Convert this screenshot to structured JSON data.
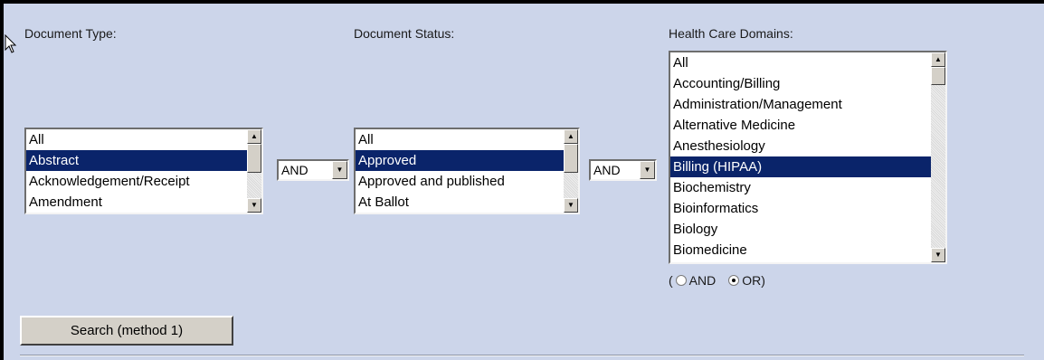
{
  "labels": {
    "document_type": "Document Type:",
    "document_status": "Document Status:",
    "health_care_domains": "Health Care Domains:"
  },
  "document_type_list": {
    "options": [
      "All",
      "Abstract",
      "Acknowledgement/Receipt",
      "Amendment"
    ],
    "selected": "Abstract"
  },
  "operator_1": {
    "value": "AND",
    "arrow_icon": "dropdown-arrow-icon"
  },
  "document_status_list": {
    "options": [
      "All",
      "Approved",
      "Approved and published",
      "At Ballot"
    ],
    "selected": "Approved"
  },
  "operator_2": {
    "value": "AND",
    "arrow_icon": "dropdown-arrow-icon"
  },
  "health_care_domains_list": {
    "options": [
      "All",
      "Accounting/Billing",
      "Administration/Management",
      "Alternative Medicine",
      "Anesthesiology",
      "Billing (HIPAA)",
      "Biochemistry",
      "Bioinformatics",
      "Biology",
      "Biomedicine"
    ],
    "selected": "Billing (HIPAA)"
  },
  "domain_combine": {
    "open_paren": "(",
    "and_label": "AND",
    "or_label": "OR)",
    "selected": "OR"
  },
  "search_button": {
    "label": "Search (method 1)"
  },
  "colors": {
    "background": "#ccd5ea",
    "selection": "#0a246a",
    "button_face": "#d4d0c8"
  }
}
